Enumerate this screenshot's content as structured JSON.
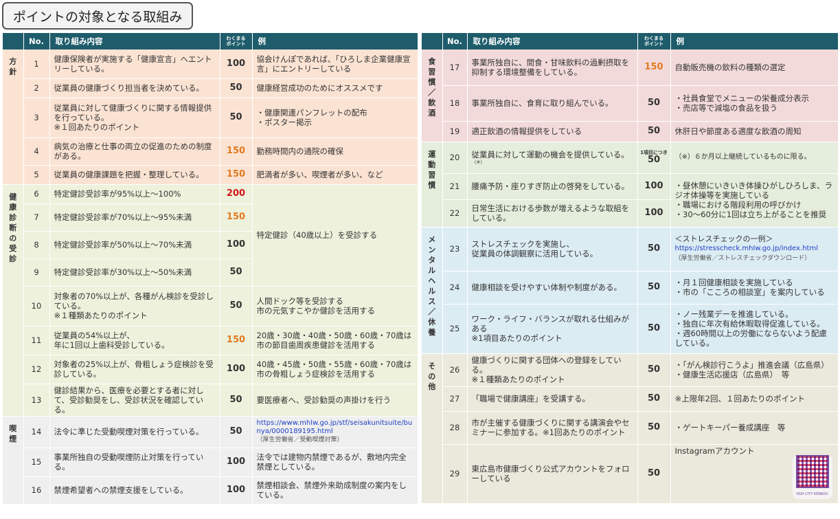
{
  "title": "ポイントの対象となる取組み",
  "headers": {
    "no": "No.",
    "content": "取り組み内容",
    "points_a": "わくまる",
    "points_b": "ポイント",
    "example": "例"
  },
  "left_categories": [
    "方針",
    "健康診断の受診",
    "喫煙"
  ],
  "right_categories": [
    "食習慣／飲酒",
    "運動習慣",
    "メンタルヘルス／休養",
    "その他"
  ],
  "rows": {
    "r1": {
      "no": "1",
      "content": "健康保険者が実施する「健康宣言」へエントリーしている。",
      "points": "100",
      "example": "協会けんぽであれば、「ひろしま企業健康宣言」にエントリーしている"
    },
    "r2": {
      "no": "2",
      "content": "従業員の健康づくり担当者を決めている。",
      "points": "50",
      "example": "健康経営成功のためにオススメです"
    },
    "r3": {
      "no": "3",
      "content": "従業員に対して健康づくりに関する情報提供を行っている。",
      "content2": "※１回あたりのポイント",
      "points": "50",
      "example": "・健康関連パンフレットの配布",
      "example2": "・ポスター掲示"
    },
    "r4": {
      "no": "4",
      "content": "病気の治療と仕事の両立の促進のための制度がある。",
      "points": "150",
      "example": "勤務時間内の通院の確保"
    },
    "r5": {
      "no": "5",
      "content": "従業員の健康課題を把握・整理している。",
      "points": "150",
      "example": "肥満者が多い、喫煙者が多い、など"
    },
    "r6": {
      "no": "6",
      "content": "特定健診受診率が95%以上～100%",
      "points": "200",
      "example": "特定健診（40歳以上）を受診する"
    },
    "r7": {
      "no": "7",
      "content": "特定健診受診率が70%以上～95%未満",
      "points": "150"
    },
    "r8": {
      "no": "8",
      "content": "特定健診受診率が50%以上～70%未満",
      "points": "100"
    },
    "r9": {
      "no": "9",
      "content": "特定健診受診率が30%以上～50%未満",
      "points": "50"
    },
    "r10": {
      "no": "10",
      "content": "対象者の70%以上が、各種がん検診を受診している。",
      "content2": "※１種類あたりのポイント",
      "points": "50",
      "example": "人間ドック等を受診する",
      "example2": "市の元気すこやか健診を活用する"
    },
    "r11": {
      "no": "11",
      "content": "従業員の54%以上が、",
      "content2": "年に1回以上歯科受診している。",
      "points": "150",
      "example": "20歳・30歳・40歳・50歳・60歳・70歳は市の節目歯周疾患健診を活用する"
    },
    "r12": {
      "no": "12",
      "content": "対象者の25%以上が、骨粗しょう症検診を受診している。",
      "points": "100",
      "example": "40歳・45歳・50歳・55歳・60歳・70歳は市の骨粗しょう症検診を活用する"
    },
    "r13": {
      "no": "13",
      "content": "健診結果から、医療を必要とする者に対して、受診勧奨をし、受診状況を確認している。",
      "points": "50",
      "example": "要医療者へ、受診勧奨の声掛けを行う"
    },
    "r14": {
      "no": "14",
      "content": "法令に準じた受動喫煙対策を行っている。",
      "points": "50",
      "example": "https://www.mhlw.go.jp/stf/seisakunitsuite/bunya/0000189195.html",
      "example2": "（厚生労働省／受動喫煙対策）"
    },
    "r15": {
      "no": "15",
      "content": "事業所独自の受動喫煙防止対策を行っている。",
      "points": "100",
      "example": "法令では建物内禁煙であるが、敷地内完全禁煙としている。"
    },
    "r16": {
      "no": "16",
      "content": "禁煙希望者への禁煙支援をしている。",
      "points": "100",
      "example": "禁煙相談会、禁煙外来助成制度の案内をしている。"
    },
    "r17": {
      "no": "17",
      "content": "事業所独自に、間食・甘味飲料の過剰摂取を抑制する環境整備をしている。",
      "points": "150",
      "example": "自動販売機の飲料の種類の選定"
    },
    "r18": {
      "no": "18",
      "content": "事業所独自に、食育に取り組んでいる。",
      "points": "50",
      "example": "・社員食堂でメニューの栄養成分表示",
      "example2": "・売店等で減塩の食品を扱う"
    },
    "r19": {
      "no": "19",
      "content": "適正飲酒の情報提供をしている",
      "points": "50",
      "example": "休肝日や節度ある適度な飲酒の周知"
    },
    "r20": {
      "no": "20",
      "content": "従業員に対して運動の機会を提供している。",
      "note": "（※）",
      "points_note": "1項目につき",
      "points": "50",
      "example": "（※）６か月以上継続しているものに限る。"
    },
    "r21": {
      "no": "21",
      "content": "腰痛予防・座りすぎ防止の啓発をしている。",
      "points": "100",
      "example": "・昼休憩にいきいき体操ひがしひろしま、ラジオ体操等を実施している",
      "example2": "・職場における階段利用の呼びかけ",
      "example3": "・30～60分に1回は立ち上がることを推奨"
    },
    "r22": {
      "no": "22",
      "content": "日常生活における歩数が増えるような取組をしている。",
      "points": "100"
    },
    "r23": {
      "no": "23",
      "content": "ストレスチェックを実施し、",
      "content2": "従業員の体調観察に活用している。",
      "points": "50",
      "example": "＜ストレスチェックの一例＞",
      "example2": "https://stresscheck.mhlw.go.jp/index.html",
      "example3": "（厚生労働省／ストレスチェックダウンロード）"
    },
    "r24": {
      "no": "24",
      "content": "健康相談を受けやすい体制や制度がある。",
      "points": "50",
      "example": "・月１回健康相談を実施している",
      "example2": "・市の「こころの相談室」を案内している"
    },
    "r25": {
      "no": "25",
      "content": "ワーク・ライフ・バランスが取れる仕組みがある",
      "content2": "※1項目あたりのポイント",
      "points": "50",
      "example": "・ノー残業デーを推進している。",
      "example2": "・独自に年次有給休暇取得促進している。",
      "example3": "・週60時間以上の労働にならないよう配慮している。"
    },
    "r26": {
      "no": "26",
      "content": "健康づくりに関する団体への登録をしている。",
      "content2": "※１種類あたりのポイント",
      "points": "50",
      "example": "・「がん検診行こうよ」推進会議（広島県）",
      "example2": "・健康生活応援店（広島県）　等"
    },
    "r27": {
      "no": "27",
      "content": "「職場で健康講座」を受講する。",
      "points": "50",
      "example": "※上限年2回、１回あたりのポイント"
    },
    "r28": {
      "no": "28",
      "content": "市が主催する健康づくりに関する講演会やセミナーに参加する。※1回あたりのポイント",
      "points": "50",
      "example": "・ゲートキーパー養成講座　等"
    },
    "r29": {
      "no": "29",
      "content": "東広島市健康づくり公式アカウントをフォローしている",
      "points": "50",
      "example": "Instagramアカウント",
      "qr_label": "HGH CITY KENKOU"
    }
  }
}
